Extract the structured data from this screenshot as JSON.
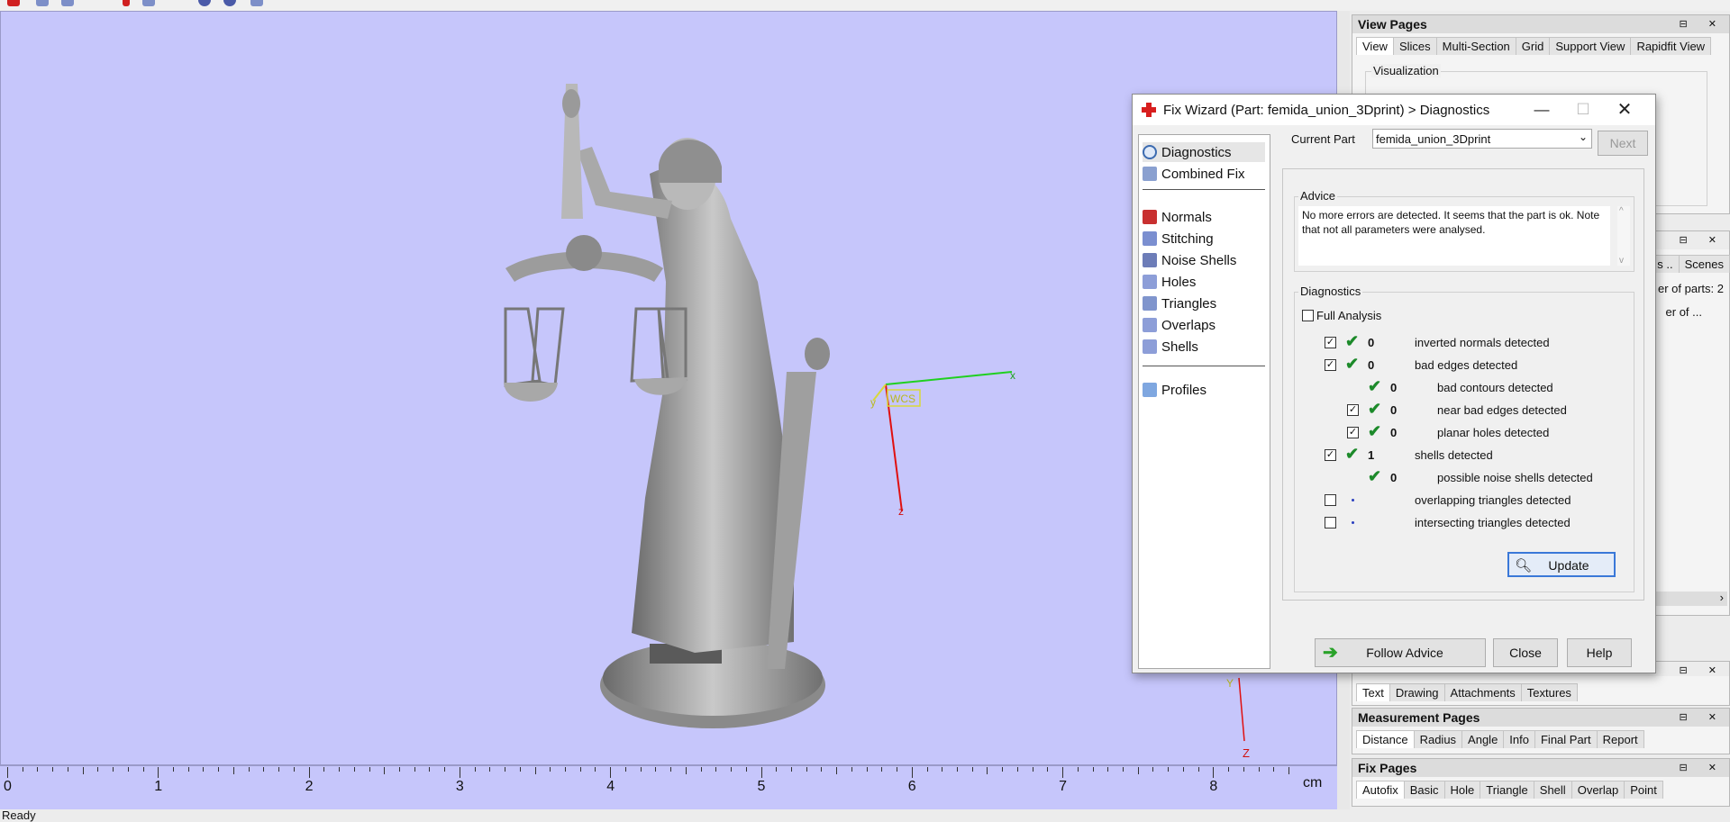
{
  "status": {
    "text": "Ready"
  },
  "viewport": {
    "axes": {
      "x": "x",
      "y": "y",
      "z": "z",
      "wcs": "WCS",
      "y2": "Y",
      "z2": "Z"
    },
    "ruler": {
      "labels": [
        "0",
        "1",
        "2",
        "3",
        "4",
        "5",
        "6",
        "7",
        "8"
      ],
      "unit": "cm"
    }
  },
  "view_pages": {
    "title": "View Pages",
    "tabs": [
      "View",
      "Slices",
      "Multi-Section",
      "Grid",
      "Support View",
      "Rapidfit View"
    ],
    "group_label": "Visualization"
  },
  "parts_panel": {
    "tabs": [
      "s ..",
      "Scenes"
    ],
    "count_text": "er of parts: 2",
    "column_text": "er of ..."
  },
  "attach_panel": {
    "tabs": [
      "Text",
      "Drawing",
      "Attachments",
      "Textures"
    ]
  },
  "measurement_pages": {
    "title": "Measurement Pages",
    "tabs": [
      "Distance",
      "Radius",
      "Angle",
      "Info",
      "Final Part",
      "Report"
    ]
  },
  "fix_pages": {
    "title": "Fix Pages",
    "tabs": [
      "Autofix",
      "Basic",
      "Hole",
      "Triangle",
      "Shell",
      "Overlap",
      "Point"
    ]
  },
  "dialog": {
    "title": "Fix Wizard (Part: femida_union_3Dprint) > Diagnostics",
    "nav": [
      {
        "label": "Diagnostics",
        "icon": "magnifier-icon"
      },
      {
        "label": "Combined Fix",
        "icon": "cube-icon"
      },
      {
        "label": "Normals",
        "icon": "normals-cube-icon"
      },
      {
        "label": "Stitching",
        "icon": "stitching-cube-icon"
      },
      {
        "label": "Noise Shells",
        "icon": "noise-shells-icon"
      },
      {
        "label": "Holes",
        "icon": "holes-cube-icon"
      },
      {
        "label": "Triangles",
        "icon": "triangles-cube-icon"
      },
      {
        "label": "Overlaps",
        "icon": "overlaps-cube-icon"
      },
      {
        "label": "Shells",
        "icon": "shells-cube-icon"
      },
      {
        "label": "Profiles",
        "icon": "document-icon"
      }
    ],
    "current_part_label": "Current Part",
    "current_part_value": "femida_union_3Dprint",
    "next_label": "Next",
    "advice_label": "Advice",
    "advice_text": "No more errors are detected. It seems that the part is ok. Note that not all parameters were analysed.",
    "diagnostics_label": "Diagnostics",
    "full_analysis_label": "Full Analysis",
    "rows": [
      {
        "count": "0",
        "label": "inverted normals detected"
      },
      {
        "count": "0",
        "label": "bad edges detected"
      },
      {
        "count": "0",
        "label": "bad contours detected"
      },
      {
        "count": "0",
        "label": "near bad edges detected"
      },
      {
        "count": "0",
        "label": "planar holes detected"
      },
      {
        "count": "1",
        "label": "shells detected"
      },
      {
        "count": "0",
        "label": "possible noise shells detected"
      },
      {
        "count": "",
        "label": "overlapping triangles detected"
      },
      {
        "count": "",
        "label": "intersecting triangles detected"
      }
    ],
    "update_label": "Update",
    "follow_advice_label": "Follow Advice",
    "close_label": "Close",
    "help_label": "Help"
  }
}
